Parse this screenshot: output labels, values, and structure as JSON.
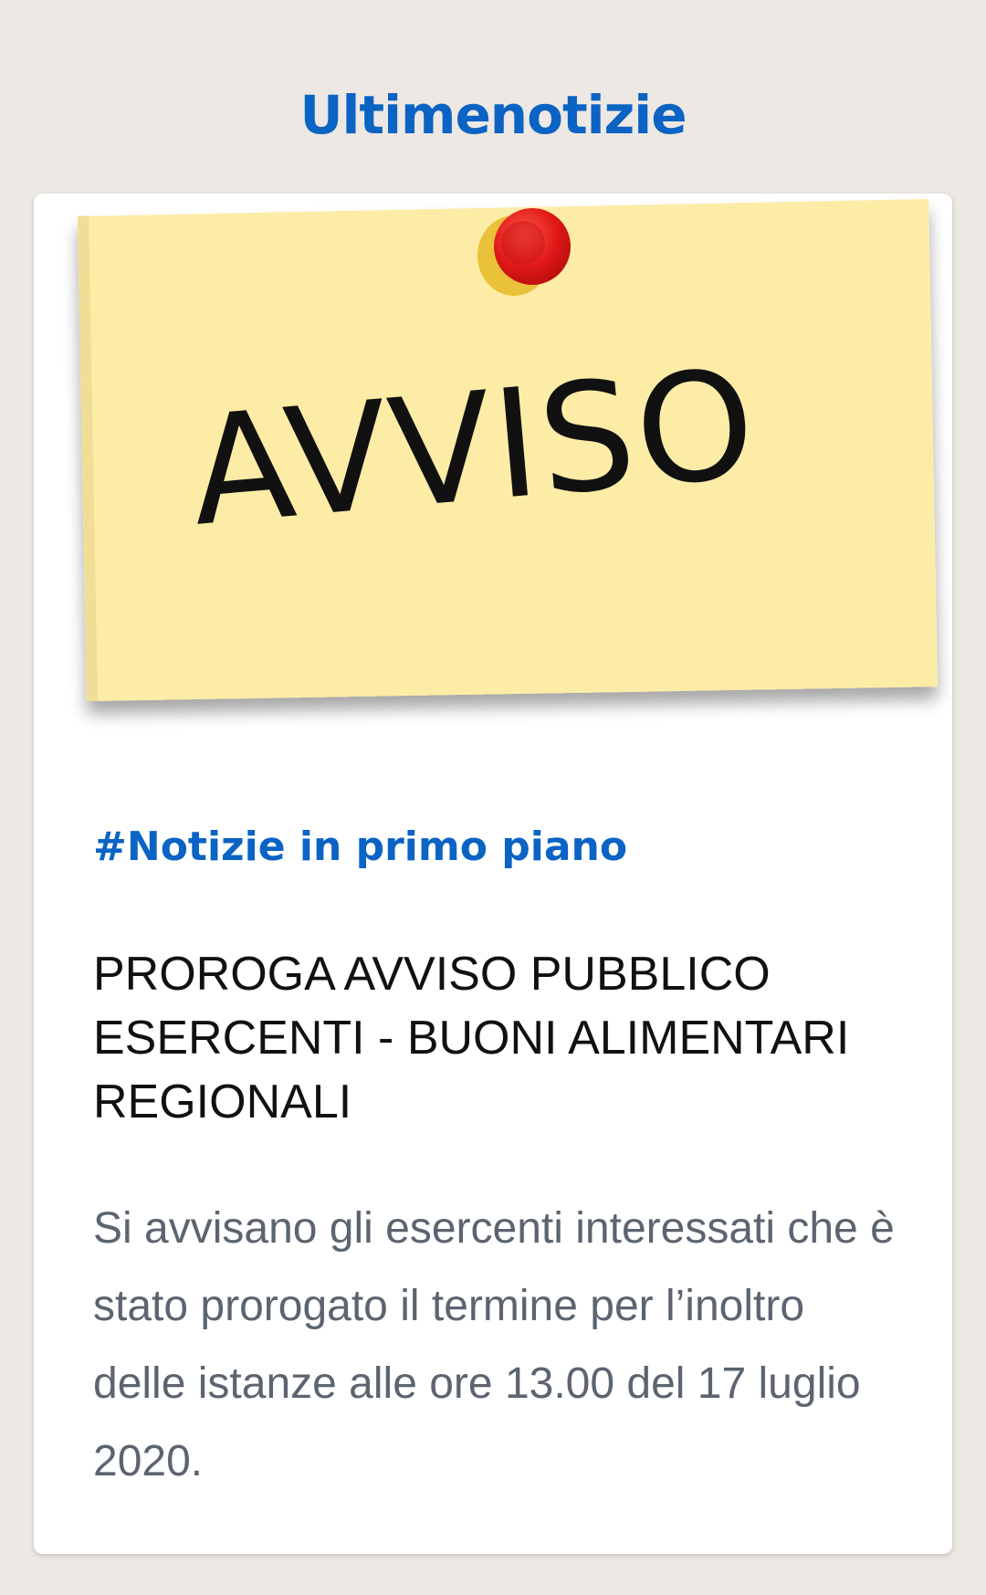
{
  "section": {
    "title": "Ultimenotizie"
  },
  "card": {
    "image_text": "AVVISO",
    "category": "#Notizie in primo piano",
    "headline": "PROROGA AVVISO PUBBLICO ESERCENTI - BUONI ALIMENTARI REGIONALI",
    "excerpt": "Si avvisano gli esercenti interessati che è stato prorogato il termine per l’inoltro delle istanze alle ore 13.00 del 17 luglio 2020."
  },
  "colors": {
    "background": "#ede8e3",
    "accent": "#0b63c4",
    "note_paper": "#fdeca6",
    "pin": "#e01818"
  },
  "icons": {
    "pin": "pushpin-icon"
  }
}
